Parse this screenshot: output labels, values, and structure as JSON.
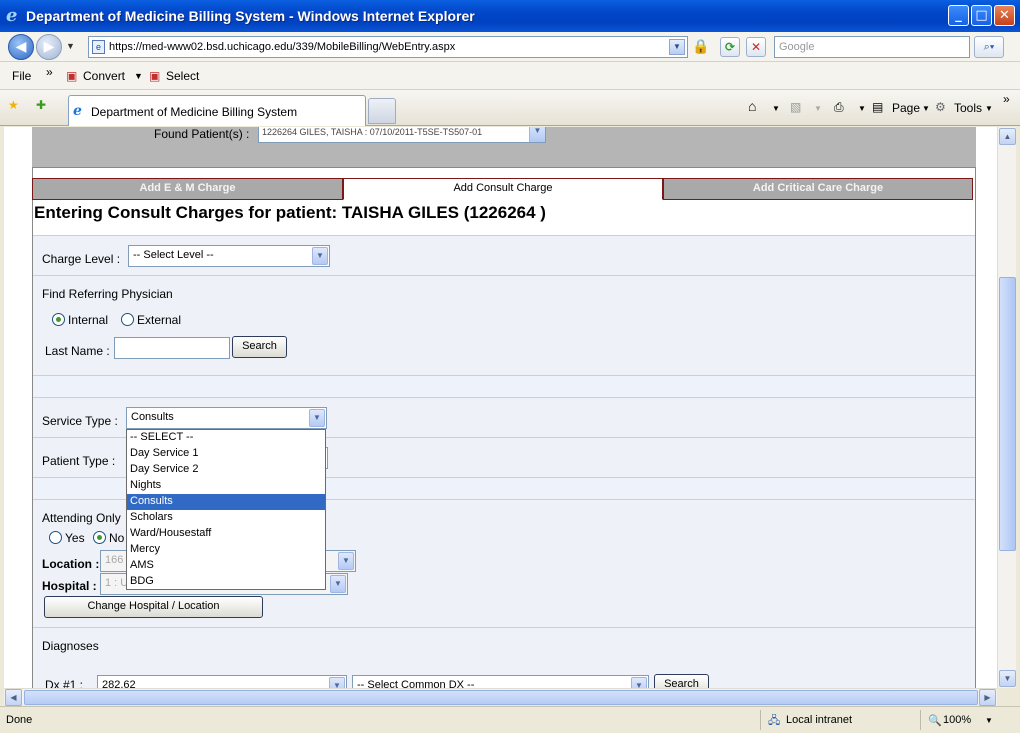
{
  "window": {
    "title": "Department of Medicine Billing System - Windows Internet Explorer",
    "min_glyph": "_",
    "max_glyph": "□",
    "close_glyph": "✕"
  },
  "browser": {
    "url": "https://med-www02.bsd.uchicago.edu/339/MobileBilling/WebEntry.aspx",
    "search_placeholder": "Google",
    "menu_file": "File",
    "chevron": "»",
    "convert_label": "Convert",
    "select_label": "Select",
    "tab_title": "Department of Medicine Billing System",
    "page_label": "Page",
    "tools_label": "Tools"
  },
  "page": {
    "found_label": "Found Patient(s) :",
    "found_value": "1226264 GILES, TAISHA : 07/10/2011-T5SE-TS507-01",
    "tabs": [
      {
        "label": "Add E & M Charge",
        "active": false
      },
      {
        "label": "Add Consult Charge",
        "active": true
      },
      {
        "label": "Add Critical Care Charge",
        "active": false
      }
    ],
    "heading": "Entering Consult Charges for patient: TAISHA GILES (1226264 )",
    "charge_level_label": "Charge Level :",
    "charge_level_value": "-- Select Level --",
    "find_ref_label": "Find Referring Physician",
    "radio_internal": "Internal",
    "radio_external": "External",
    "last_name_label": "Last Name :",
    "search_button": "Search",
    "service_type_label": "Service Type :",
    "service_type_value": "Consults",
    "service_type_options": [
      "-- SELECT --",
      "Day Service 1",
      "Day Service 2",
      "Nights",
      "Consults",
      "Scholars",
      "Ward/Housestaff",
      "Mercy",
      "AMS",
      "BDG"
    ],
    "service_type_selected_index": 4,
    "patient_type_label": "Patient Type :",
    "attending_only_label": "Attending Only",
    "radio_yes": "Yes",
    "radio_no": "No",
    "location_label": "Location :",
    "location_value": "166",
    "hospital_label": "Hospital :",
    "hospital_value": "1 : U",
    "change_hospital_button": "Change Hospital / Location",
    "diagnoses_label": "Diagnoses",
    "dx1_label": "Dx #1 :",
    "dx1_value": "282.62",
    "common_dx_value": "-- Select Common DX --",
    "dx_search_button": "Search"
  },
  "status": {
    "text": "Done",
    "zone": "Local intranet",
    "zoom": "100%"
  }
}
